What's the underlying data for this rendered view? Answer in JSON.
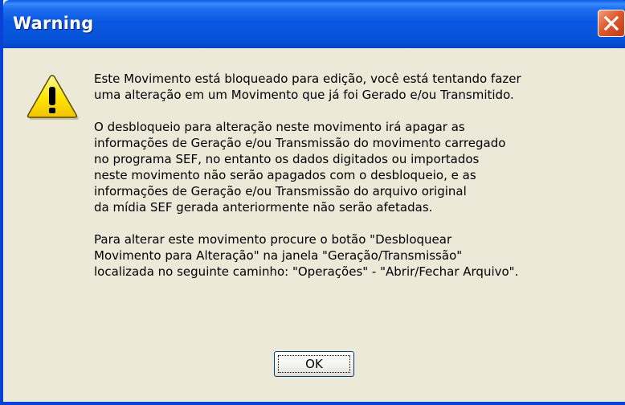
{
  "dialog": {
    "title": "Warning",
    "close_icon": "close-icon",
    "icon": "warning-icon",
    "paragraphs": [
      [
        "Este Movimento está bloqueado para edição, você está tentando fazer",
        "uma alteração em um Movimento que já foi Gerado e/ou Transmitido."
      ],
      [
        "O desbloqueio para alteração neste movimento irá apagar as",
        "informações de Geração e/ou Transmissão do movimento carregado",
        "no programa SEF, no entanto os dados digitados ou importados",
        "neste movimento não serão apagados com o desbloqueio, e as",
        "informações de Geração e/ou Transmissão do arquivo original",
        "da mídia SEF gerada anteriormente não serão afetadas."
      ],
      [
        "Para alterar este movimento procure o botão \"Desbloquear",
        "Movimento para Alteração\" na janela \"Geração/Transmissão\"",
        "localizada no seguinte caminho: \"Operações\" - \"Abrir/Fechar Arquivo\"."
      ]
    ],
    "ok_label": "OK"
  },
  "colors": {
    "titlebar": "#0a58e2",
    "close_button": "#e05a2e",
    "dialog_background": "#ece9d8",
    "warning_yellow": "#ffe600"
  }
}
